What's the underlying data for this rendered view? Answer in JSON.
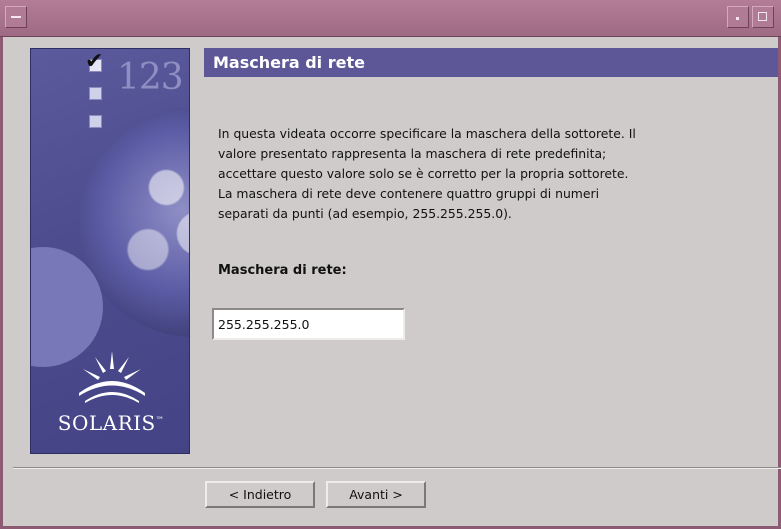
{
  "window": {
    "accent_color": "#a7718b",
    "header_color": "#5d5798",
    "titlebar_icons": [
      "window-menu-icon",
      "minimize-icon",
      "maximize-icon"
    ]
  },
  "side_panel": {
    "step_number": "123",
    "brand": "SOLARIS",
    "brand_mark": "™",
    "icons": [
      "checkbox-checked-icon",
      "checkbox-icon",
      "checkbox-icon",
      "globe-image",
      "sun-logo-icon"
    ]
  },
  "header": {
    "title": "Maschera di rete"
  },
  "description": {
    "lines": [
      "In questa videata occorre specificare la maschera della sottorete. Il",
      "valore presentato rappresenta la maschera di rete predefinita;",
      "accettare questo valore solo se è corretto per la propria sottorete.",
      "La maschera di rete deve contenere quattro gruppi di numeri",
      "separati da punti (ad esempio, 255.255.255.0)."
    ]
  },
  "form": {
    "label": "Maschera di rete:",
    "value": "255.255.255.0"
  },
  "buttons": {
    "back": "< Indietro",
    "next": "Avanti >"
  }
}
